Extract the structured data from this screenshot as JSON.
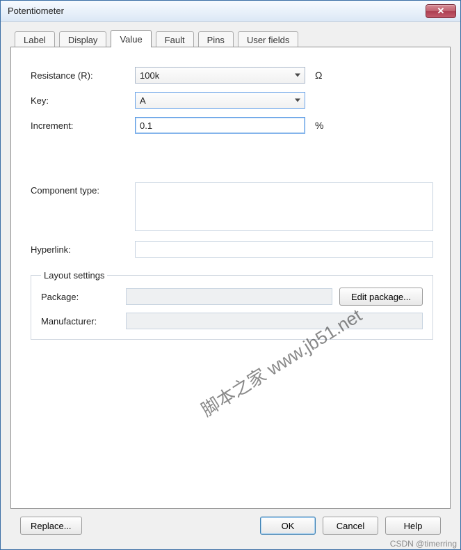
{
  "window": {
    "title": "Potentiometer"
  },
  "tabs": [
    {
      "label": "Label"
    },
    {
      "label": "Display"
    },
    {
      "label": "Value"
    },
    {
      "label": "Fault"
    },
    {
      "label": "Pins"
    },
    {
      "label": "User fields"
    }
  ],
  "active_tab_index": 2,
  "value_tab": {
    "resistance_label": "Resistance (R):",
    "resistance_value": "100k",
    "resistance_unit": "Ω",
    "key_label": "Key:",
    "key_value": "A",
    "increment_label": "Increment:",
    "increment_value": "0.1",
    "increment_unit": "%",
    "component_type_label": "Component type:",
    "component_type_value": "",
    "hyperlink_label": "Hyperlink:",
    "hyperlink_value": ""
  },
  "layout_settings": {
    "legend": "Layout settings",
    "package_label": "Package:",
    "package_value": "",
    "manufacturer_label": "Manufacturer:",
    "manufacturer_value": "",
    "edit_package_button": "Edit package..."
  },
  "footer": {
    "replace": "Replace...",
    "ok": "OK",
    "cancel": "Cancel",
    "help": "Help"
  },
  "watermarks": {
    "diagonal": "脚本之家 www.jb51.net",
    "corner": "CSDN @timerring"
  }
}
